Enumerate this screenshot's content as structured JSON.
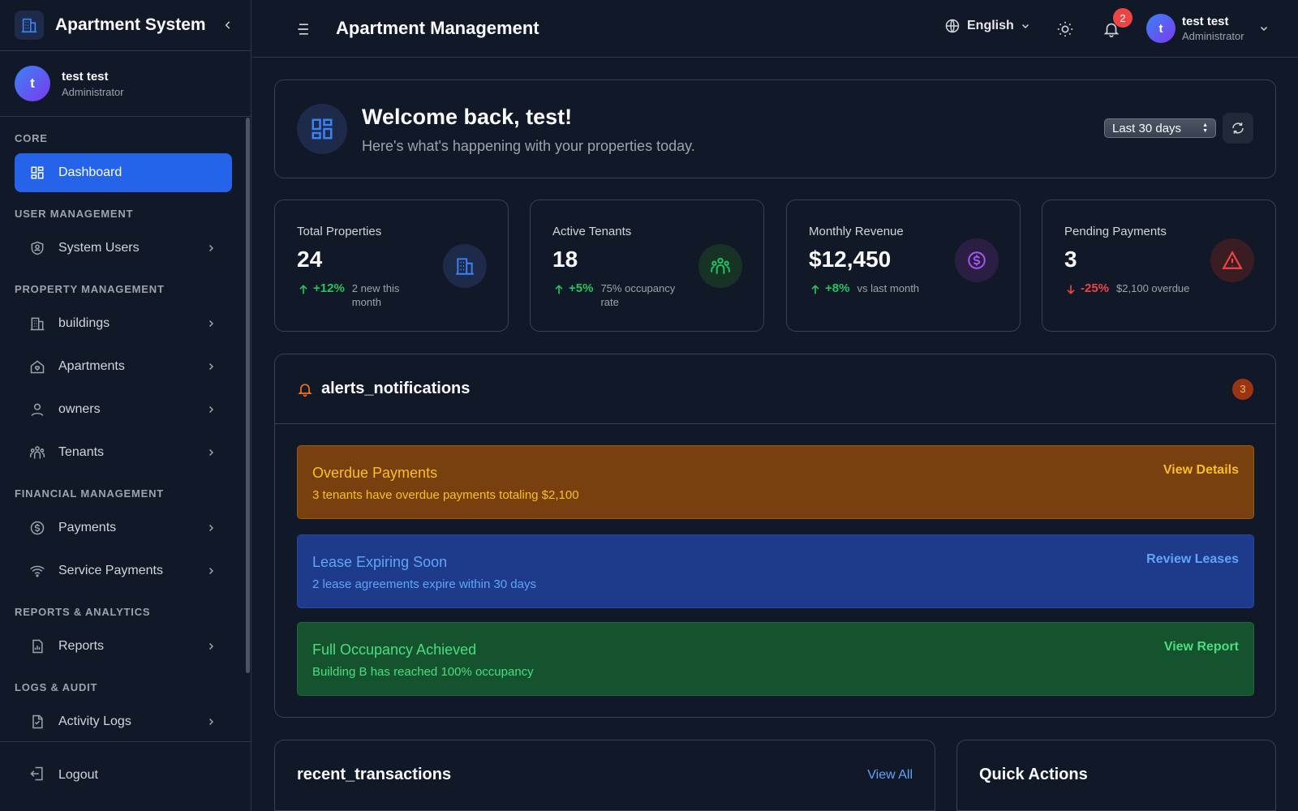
{
  "app": {
    "title": "Apartment System"
  },
  "current_user": {
    "initial": "t",
    "name": "test test",
    "role": "Administrator"
  },
  "sidebar": {
    "sections": [
      {
        "label": "CORE",
        "items": [
          {
            "label": "Dashboard",
            "icon": "dashboard-icon",
            "active": true
          }
        ]
      },
      {
        "label": "USER MANAGEMENT",
        "items": [
          {
            "label": "System Users",
            "icon": "shield-user-icon"
          }
        ]
      },
      {
        "label": "PROPERTY MANAGEMENT",
        "items": [
          {
            "label": "buildings",
            "icon": "building-icon"
          },
          {
            "label": "Apartments",
            "icon": "home-heart-icon"
          },
          {
            "label": "owners",
            "icon": "user-icon"
          },
          {
            "label": "Tenants",
            "icon": "users-icon"
          }
        ]
      },
      {
        "label": "FINANCIAL MANAGEMENT",
        "items": [
          {
            "label": "Payments",
            "icon": "dollar-circle-icon"
          },
          {
            "label": "Service Payments",
            "icon": "wifi-icon"
          }
        ]
      },
      {
        "label": "REPORTS & ANALYTICS",
        "items": [
          {
            "label": "Reports",
            "icon": "report-chart-icon"
          }
        ]
      },
      {
        "label": "LOGS & AUDIT",
        "items": [
          {
            "label": "Activity Logs",
            "icon": "document-icon"
          }
        ]
      }
    ],
    "logout_label": "Logout"
  },
  "topbar": {
    "page_title": "Apartment Management",
    "language": "English",
    "notification_count": "2"
  },
  "welcome": {
    "title": "Welcome back, test!",
    "subtitle": "Here's what's happening with your properties today.",
    "period": "Last 30 days"
  },
  "stats": [
    {
      "label": "Total Properties",
      "value": "24",
      "change": "+12%",
      "direction": "up",
      "note": "2 new this month",
      "icon": "building-icon",
      "color": "#3b82f6",
      "ring": "#1e2a4a"
    },
    {
      "label": "Active Tenants",
      "value": "18",
      "change": "+5%",
      "direction": "up",
      "note": "75% occupancy rate",
      "icon": "users-icon",
      "color": "#22c55e",
      "ring": "#163326"
    },
    {
      "label": "Monthly Revenue",
      "value": "$12,450",
      "change": "+8%",
      "direction": "up",
      "note": "vs last month",
      "icon": "dollar-circle-icon",
      "color": "#a855f7",
      "ring": "#2a1f42"
    },
    {
      "label": "Pending Payments",
      "value": "3",
      "change": "-25%",
      "direction": "down",
      "note": "$2,100 overdue",
      "icon": "warning-icon",
      "color": "#ef4444",
      "ring": "#3a1d22"
    }
  ],
  "alerts": {
    "title": "alerts_notifications",
    "count": "3",
    "items": [
      {
        "title": "Overdue Payments",
        "description": "3 tenants have overdue payments totaling $2,100",
        "action": "View Details",
        "kind": "warning"
      },
      {
        "title": "Lease Expiring Soon",
        "description": "2 lease agreements expire within 30 days",
        "action": "Review Leases",
        "kind": "info"
      },
      {
        "title": "Full Occupancy Achieved",
        "description": "Building B has reached 100% occupancy",
        "action": "View Report",
        "kind": "success"
      }
    ]
  },
  "transactions": {
    "title": "recent_transactions",
    "view_all": "View All"
  },
  "quick_actions": {
    "title": "Quick Actions"
  },
  "colors": {
    "accent": "#2563eb",
    "up": "#22c55e",
    "down": "#ef4444"
  }
}
